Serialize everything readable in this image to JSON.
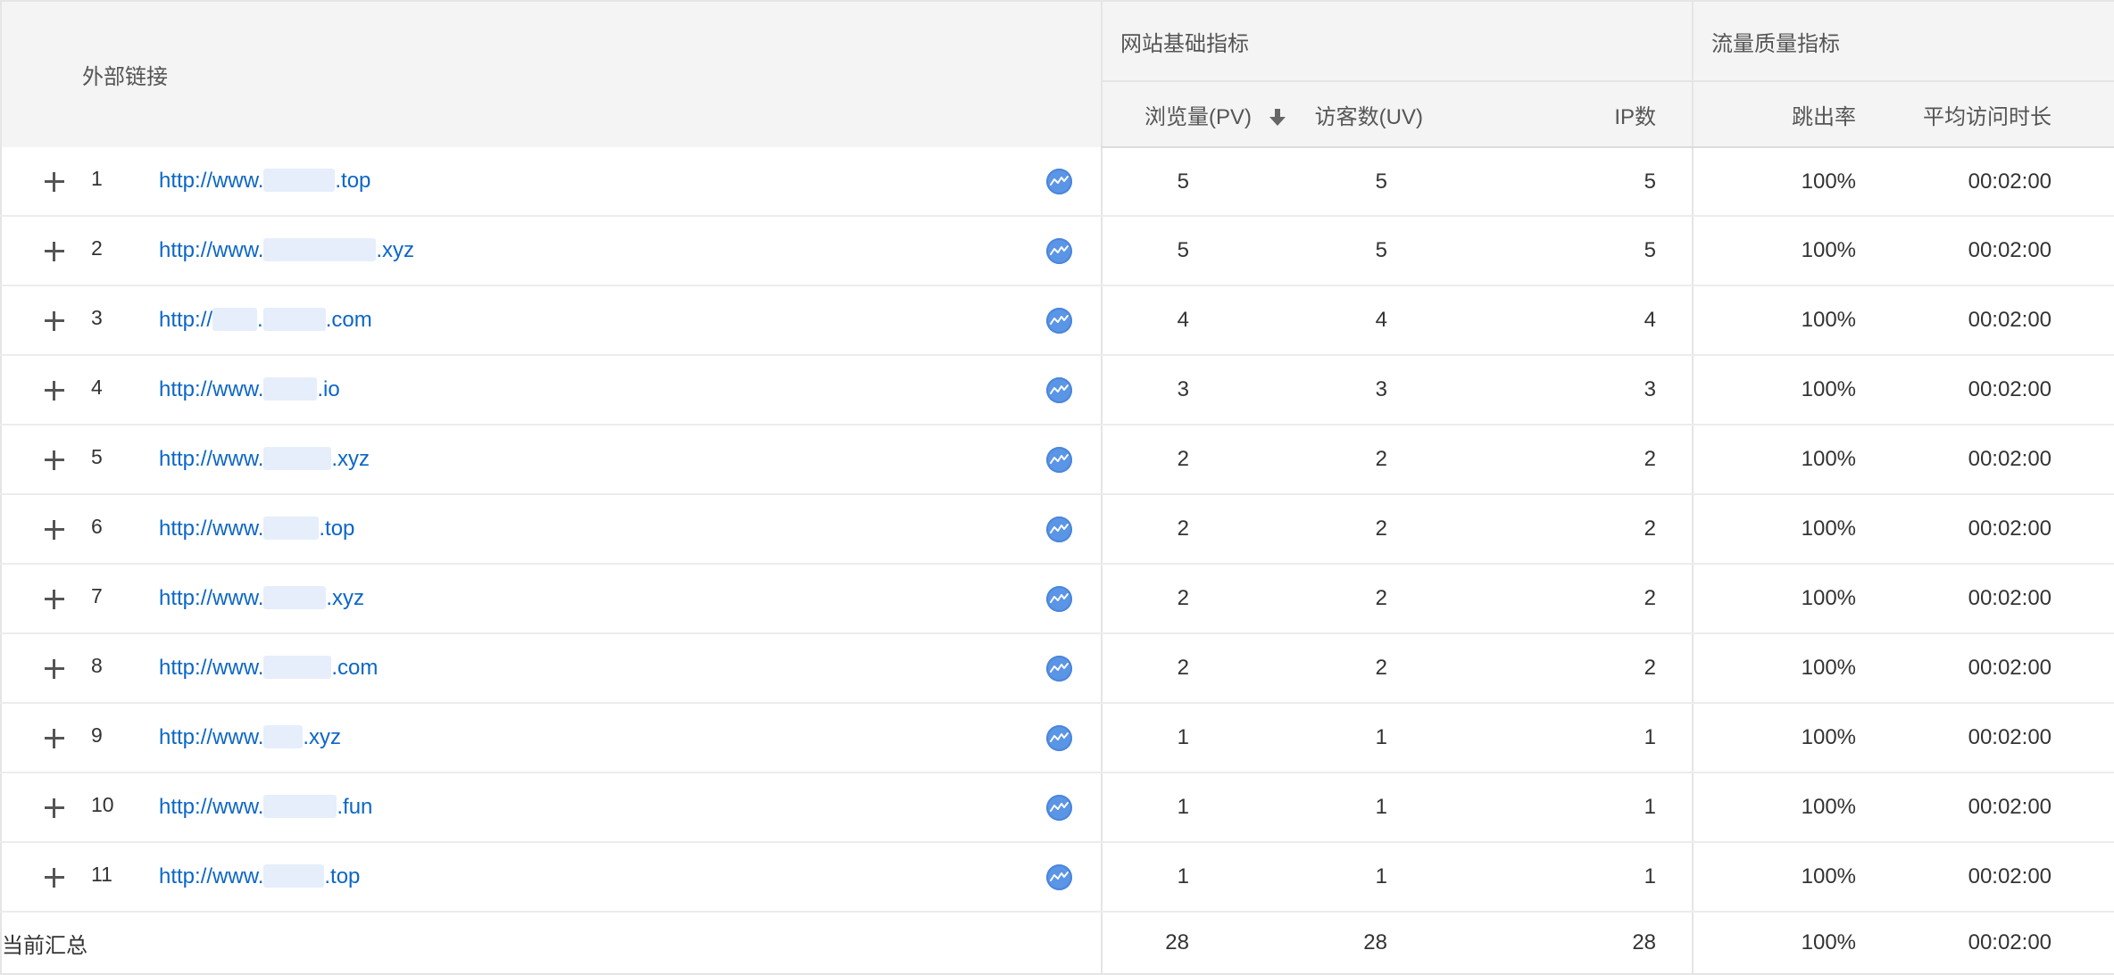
{
  "header": {
    "link_column": "外部链接",
    "group_basic": "网站基础指标",
    "group_quality": "流量质量指标",
    "col_pv": "浏览量(PV)",
    "col_uv": "访客数(UV)",
    "col_ip": "IP数",
    "col_bounce": "跳出率",
    "col_duration": "平均访问时长",
    "sorted_column_icon": "sort-desc-arrow-icon"
  },
  "rows": [
    {
      "rank": "1",
      "url_prefix": "http://www.",
      "url_suffix": ".top",
      "pv": "5",
      "uv": "5",
      "ip": "5",
      "bounce": "100%",
      "duration": "00:02:00"
    },
    {
      "rank": "2",
      "url_prefix": "http://www.",
      "url_suffix": ".xyz",
      "pv": "5",
      "uv": "5",
      "ip": "5",
      "bounce": "100%",
      "duration": "00:02:00"
    },
    {
      "rank": "3",
      "url_prefix": "http://",
      "url_suffix": ".com",
      "pv": "4",
      "uv": "4",
      "ip": "4",
      "bounce": "100%",
      "duration": "00:02:00"
    },
    {
      "rank": "4",
      "url_prefix": "http://www.",
      "url_suffix": ".io",
      "pv": "3",
      "uv": "3",
      "ip": "3",
      "bounce": "100%",
      "duration": "00:02:00"
    },
    {
      "rank": "5",
      "url_prefix": "http://www.",
      "url_suffix": ".xyz",
      "pv": "2",
      "uv": "2",
      "ip": "2",
      "bounce": "100%",
      "duration": "00:02:00"
    },
    {
      "rank": "6",
      "url_prefix": "http://www.",
      "url_suffix": ".top",
      "pv": "2",
      "uv": "2",
      "ip": "2",
      "bounce": "100%",
      "duration": "00:02:00"
    },
    {
      "rank": "7",
      "url_prefix": "http://www.",
      "url_suffix": ".xyz",
      "pv": "2",
      "uv": "2",
      "ip": "2",
      "bounce": "100%",
      "duration": "00:02:00"
    },
    {
      "rank": "8",
      "url_prefix": "http://www.",
      "url_suffix": ".com",
      "pv": "2",
      "uv": "2",
      "ip": "2",
      "bounce": "100%",
      "duration": "00:02:00"
    },
    {
      "rank": "9",
      "url_prefix": "http://www.",
      "url_suffix": ".xyz",
      "pv": "1",
      "uv": "1",
      "ip": "1",
      "bounce": "100%",
      "duration": "00:02:00"
    },
    {
      "rank": "10",
      "url_prefix": "http://www.",
      "url_suffix": ".fun",
      "pv": "1",
      "uv": "1",
      "ip": "1",
      "bounce": "100%",
      "duration": "00:02:00"
    },
    {
      "rank": "11",
      "url_prefix": "http://www.",
      "url_suffix": ".top",
      "pv": "1",
      "uv": "1",
      "ip": "1",
      "bounce": "100%",
      "duration": "00:02:00"
    }
  ],
  "total": {
    "label": "当前汇总",
    "pv": "28",
    "uv": "28",
    "ip": "28",
    "bounce": "100%",
    "duration": "00:02:00"
  },
  "icons": {
    "expand": "plus-icon",
    "trend": "trend-chart-icon"
  },
  "colors": {
    "link": "#0b66c8",
    "trend_icon": "#5a95e6",
    "header_bg": "#f4f4f4"
  }
}
